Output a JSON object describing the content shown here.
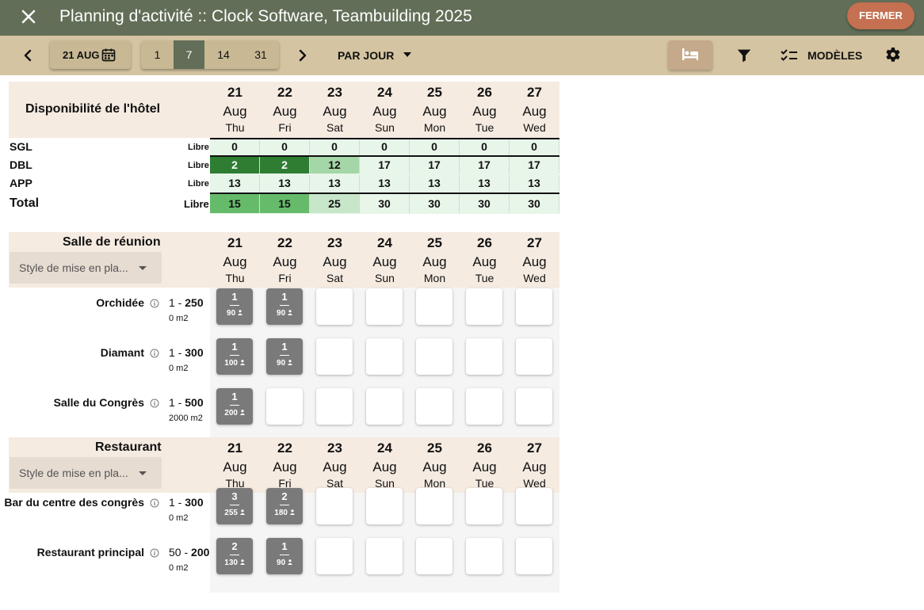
{
  "window": {
    "title": "Planning d'activité :: Clock Software, Teambuilding 2025",
    "close_button": "FERMER"
  },
  "toolbar": {
    "date": "21 AUG",
    "ranges": [
      "1",
      "7",
      "14",
      "31"
    ],
    "selected_range": "7",
    "view_mode": "PAR JOUR",
    "templates_label": "MODÈLES",
    "icons": [
      "close-icon",
      "chevron-left-icon",
      "calendar-icon",
      "chevron-right-icon",
      "caret-down-icon",
      "bed-icon",
      "filter-icon",
      "checklist-icon",
      "gear-icon"
    ],
    "colors": {
      "titlebar": "#626e57",
      "toolbar": "#d5c4a1",
      "fermer": "#c47051",
      "header_bg": "#f5ebe1"
    }
  },
  "dates": [
    {
      "day": "21",
      "month": "Aug",
      "weekday": "Thu"
    },
    {
      "day": "22",
      "month": "Aug",
      "weekday": "Fri"
    },
    {
      "day": "23",
      "month": "Aug",
      "weekday": "Sat"
    },
    {
      "day": "24",
      "month": "Aug",
      "weekday": "Sun"
    },
    {
      "day": "25",
      "month": "Aug",
      "weekday": "Mon"
    },
    {
      "day": "26",
      "month": "Aug",
      "weekday": "Tue"
    },
    {
      "day": "27",
      "month": "Aug",
      "weekday": "Wed"
    }
  ],
  "hotel": {
    "title": "Disponibilité de l'hôtel",
    "libre_label": "Libre",
    "rows": [
      {
        "label": "SGL",
        "values": [
          "0",
          "0",
          "0",
          "0",
          "0",
          "0",
          "0"
        ]
      },
      {
        "label": "DBL",
        "values": [
          "2",
          "2",
          "12",
          "17",
          "17",
          "17",
          "17"
        ]
      },
      {
        "label": "APP",
        "values": [
          "13",
          "13",
          "13",
          "13",
          "13",
          "13",
          "13"
        ]
      },
      {
        "label": "Total",
        "values": [
          "15",
          "15",
          "25",
          "30",
          "30",
          "30",
          "30"
        ]
      }
    ],
    "cell_colors": {
      "light": "#e8f5e9",
      "dark_green": "#2e7d32",
      "mid_green": "#a5d6a7",
      "total_green": "#66bb6a",
      "total_light": "#c8e6c9"
    }
  },
  "meeting": {
    "title": "Salle de réunion",
    "style_placeholder": "Style de mise en pla...",
    "rooms": [
      {
        "name": "Orchidée",
        "cap_min": "1",
        "cap_max": "250",
        "area": "0 m2",
        "bookings": [
          {
            "count": "1",
            "people": "90"
          },
          {
            "count": "1",
            "people": "90"
          },
          null,
          null,
          null,
          null,
          null
        ]
      },
      {
        "name": "Diamant",
        "cap_min": "1",
        "cap_max": "300",
        "area": "0 m2",
        "bookings": [
          {
            "count": "1",
            "people": "100"
          },
          {
            "count": "1",
            "people": "90"
          },
          null,
          null,
          null,
          null,
          null
        ]
      },
      {
        "name": "Salle du Congrès",
        "cap_min": "1",
        "cap_max": "500",
        "area": "2000 m2",
        "bookings": [
          {
            "count": "1",
            "people": "200"
          },
          null,
          null,
          null,
          null,
          null,
          null
        ]
      }
    ]
  },
  "restaurant": {
    "title": "Restaurant",
    "style_placeholder": "Style de mise en pla...",
    "rooms": [
      {
        "name": "Bar du centre des congrès",
        "cap_min": "1",
        "cap_max": "300",
        "area": "0 m2",
        "bookings": [
          {
            "count": "3",
            "people": "255"
          },
          {
            "count": "2",
            "people": "180"
          },
          null,
          null,
          null,
          null,
          null
        ]
      },
      {
        "name": "Restaurant principal",
        "cap_min": "50",
        "cap_max": "200",
        "area": "0 m2",
        "bookings": [
          {
            "count": "2",
            "people": "130"
          },
          {
            "count": "1",
            "people": "90"
          },
          null,
          null,
          null,
          null,
          null
        ]
      }
    ]
  }
}
